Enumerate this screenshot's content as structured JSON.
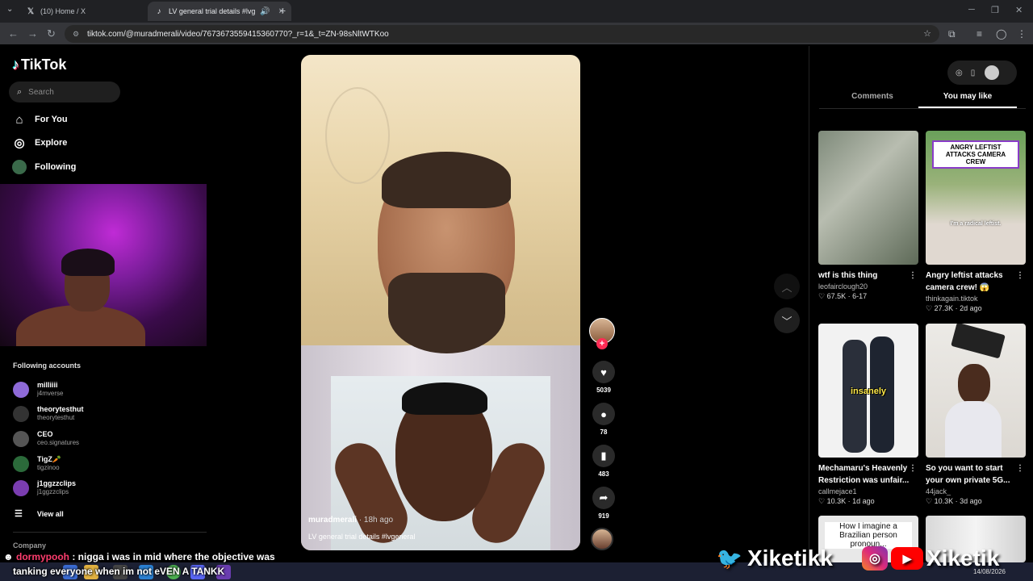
{
  "browser": {
    "tabs": [
      {
        "title": "(10) Home / X",
        "icon": "x-logo-icon"
      },
      {
        "title": "LV general trial details #lvg",
        "icon": "tiktok-icon"
      }
    ],
    "url": "tiktok.com/@muradmerali/video/7673673559415360770?_r=1&_t=ZN-98sNltWTKoo"
  },
  "sidebar": {
    "logo": "TikTok",
    "search_placeholder": "Search",
    "nav": [
      {
        "label": "For You",
        "icon": "home-icon"
      },
      {
        "label": "Explore",
        "icon": "compass-icon"
      },
      {
        "label": "Following",
        "icon": "following-avatar-icon"
      }
    ],
    "following_header": "Following accounts",
    "following": [
      {
        "name": "milliiii",
        "handle": "j4mverse",
        "color": "#8e6ad8"
      },
      {
        "name": "theorytesthut",
        "handle": "theorytesthut",
        "color": "#333333"
      },
      {
        "name": "CEO",
        "handle": "ceo.signatures",
        "color": "#555555"
      },
      {
        "name": "TigZ🥕",
        "handle": "tigzinoo",
        "color": "#2b6a3a"
      },
      {
        "name": "j1ggzzclips",
        "handle": "j1ggzzclips",
        "color": "#7a3db0"
      }
    ],
    "view_all": "View all",
    "company": "Company"
  },
  "video": {
    "author": "muradmerali",
    "ago": "· 18h ago",
    "caption": "LV general trial details #lvgeneral",
    "likes": "5039",
    "comments": "78",
    "saves": "483",
    "shares": "919"
  },
  "right": {
    "tabs": [
      "Comments",
      "You may like"
    ],
    "active_tab": "You may like",
    "cards": [
      {
        "title": "wtf is this thing",
        "author": "leofairclough20",
        "meta": "♡ 67.5K · 6-17",
        "overlay": ""
      },
      {
        "title": "Angry leftist attacks camera crew! 😱",
        "author": "thinkagain.tiktok",
        "meta": "♡ 27.3K · 2d ago",
        "overlay": "ANGRY LEFTIST ATTACKS CAMERA CREW",
        "overlay2": "I'm a radical leftist."
      },
      {
        "title": "Mechamaru's Heavenly Restriction was unfair...",
        "author": "callmejace1",
        "meta": "♡ 10.3K · 1d ago",
        "overlay": "insanely"
      },
      {
        "title": "So you want to start your own private 5G...",
        "author": "44jack_",
        "meta": "♡ 10.3K · 3d ago",
        "overlay": ""
      },
      {
        "title": "",
        "author": "",
        "meta": "",
        "overlay": "How I imagine a Brazilian person pronoun..."
      }
    ]
  },
  "stream": {
    "chat_user": "dormypooh",
    "chat_text": ": nigga i was in mid where the objective was",
    "chat_text2": "tanking everyone when im not eVEN A TANKK",
    "brand1": "Xiketikk",
    "brand2": "Xiketik"
  },
  "taskbar": {
    "date": "14/08/2026"
  }
}
